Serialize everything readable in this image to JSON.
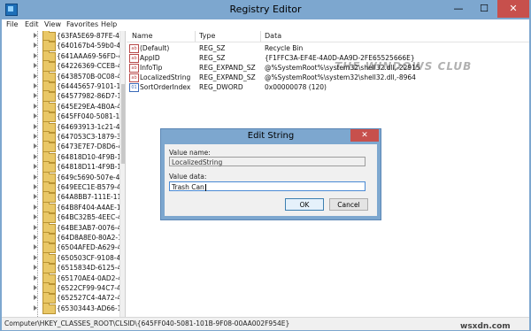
{
  "window": {
    "title": "Registry Editor",
    "minimize_glyph": "—",
    "maximize_glyph": "☐",
    "close_glyph": "✕",
    "app_icon": "regedit-icon"
  },
  "menu": [
    "File",
    "Edit",
    "View",
    "Favorites",
    "Help"
  ],
  "tree": {
    "items": [
      "{63FA5E69-87FE-432",
      "{640167b4-59b0-47a",
      "{641AAA69-56FD-40",
      "{64226369-CCEB-47",
      "{6438570B-0C08-4A",
      "{64445657-9101-11d",
      "{64577982-86D7-11c",
      "{645E29EA-4B0A-46",
      "{645FF040-5081-101",
      "{64693913-1c21-4f3",
      "{647053C3-1879-34E",
      "{6473E7E7-D8D6-49",
      "{64818D10-4F9B-11c",
      "{64818D11-4F9B-11c",
      "{649c5690-507e-494",
      "{649EEC1E-B579-4E",
      "{64A8BB7-111E-11",
      "{64B8F404-A4AE-11",
      "{64BC32B5-4EEC-4d",
      "{64BE3AB7-0076-4D",
      "{64D8A8E0-80A2-11",
      "{6504AFED-A629-45",
      "{650503CF-9108-4DI",
      "{6515834D-6125-487",
      "{65170AE4-0AD2-4F",
      "{6522CF99-94C7-49",
      "{652527C4-4A72-4b",
      "{65303443-AD66-11"
    ]
  },
  "list": {
    "headers": {
      "name": "Name",
      "type": "Type",
      "data": "Data"
    },
    "rows": [
      {
        "icon": "string-value-icon",
        "name": "(Default)",
        "type": "REG_SZ",
        "data": "Recycle Bin"
      },
      {
        "icon": "string-value-icon",
        "name": "AppID",
        "type": "REG_SZ",
        "data": "{F1FFC3A-EF4E-4A0D-AA9D-2FE65525666E}"
      },
      {
        "icon": "string-value-icon",
        "name": "InfoTip",
        "type": "REG_EXPAND_SZ",
        "data": "@%SystemRoot%\\system32\\shell32.dll,-22915"
      },
      {
        "icon": "string-value-icon",
        "name": "LocalizedString",
        "type": "REG_EXPAND_SZ",
        "data": "@%SystemRoot%\\system32\\shell32.dll,-8964"
      },
      {
        "icon": "binary-value-icon",
        "name": "SortOrderIndex",
        "type": "REG_DWORD",
        "data": "0x00000078 (120)"
      }
    ],
    "watermark": "THE WINDOWS CLUB"
  },
  "statusbar": {
    "path": "Computer\\HKEY_CLASSES_ROOT\\CLSID\\{645FF040-5081-101B-9F08-00AA002F954E}"
  },
  "credit": "wsxdn.com",
  "dialog": {
    "title": "Edit String",
    "close_glyph": "✕",
    "value_name_label": "Value name:",
    "value_name": "LocalizedString",
    "value_data_label": "Value data:",
    "value_data": "Trash Can",
    "ok_label": "OK",
    "cancel_label": "Cancel"
  }
}
